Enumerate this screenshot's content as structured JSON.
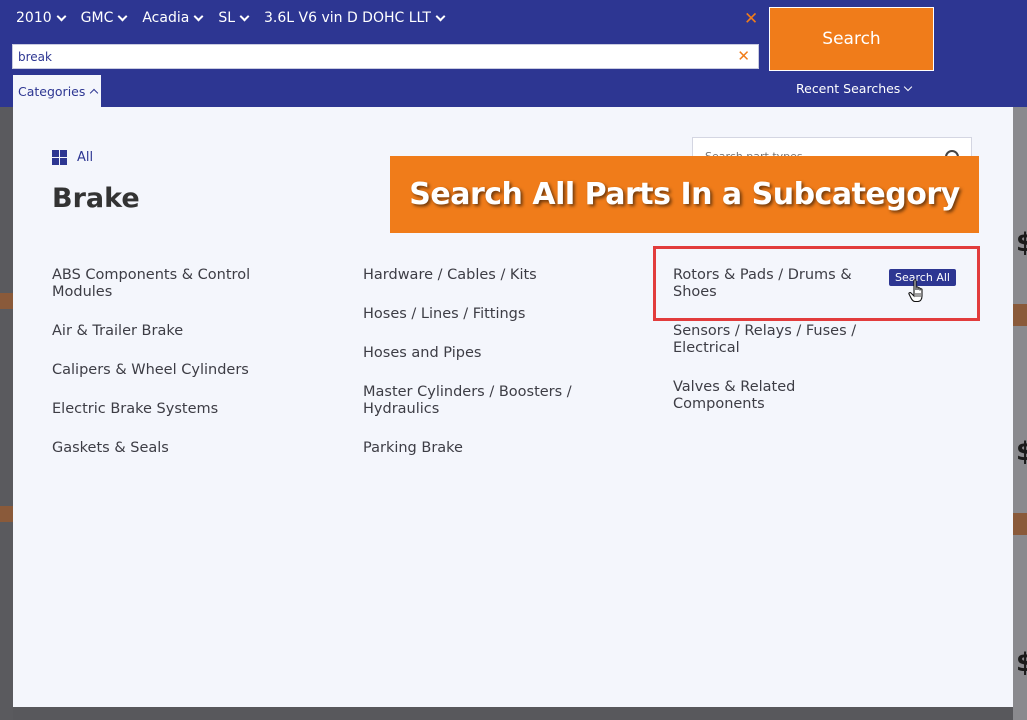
{
  "vehicle": {
    "year": "2010",
    "make": "GMC",
    "model": "Acadia",
    "trim": "SL",
    "engine": "3.6L V6 vin D DOHC LLT"
  },
  "search": {
    "value": "break",
    "button_label": "Search",
    "clear_icon": "close-icon"
  },
  "recent_searches_label": "Recent Searches",
  "categories_tab_label": "Categories",
  "panel": {
    "all_label": "All",
    "title": "Brake",
    "part_search_placeholder": "Search part types"
  },
  "banner_text": "Search All Parts In a Subcategory",
  "columns": [
    [
      "ABS Components & Control Modules",
      "Air & Trailer Brake",
      "Calipers & Wheel Cylinders",
      "Electric Brake Systems",
      "Gaskets & Seals"
    ],
    [
      "Hardware / Cables / Kits",
      "Hoses / Lines / Fittings",
      "Hoses and Pipes",
      "Master Cylinders / Boosters / Hydraulics",
      "Parking Brake"
    ],
    [
      "Rotors & Pads / Drums & Shoes",
      "Sensors / Relays / Fuses / Electrical",
      "Valves & Related Components"
    ]
  ],
  "search_all_label": "Search All",
  "colors": {
    "header_blue": "#2d3692",
    "accent_orange": "#f07c1a",
    "panel_bg": "#f4f6fc",
    "highlight_red": "#e23c3c"
  }
}
